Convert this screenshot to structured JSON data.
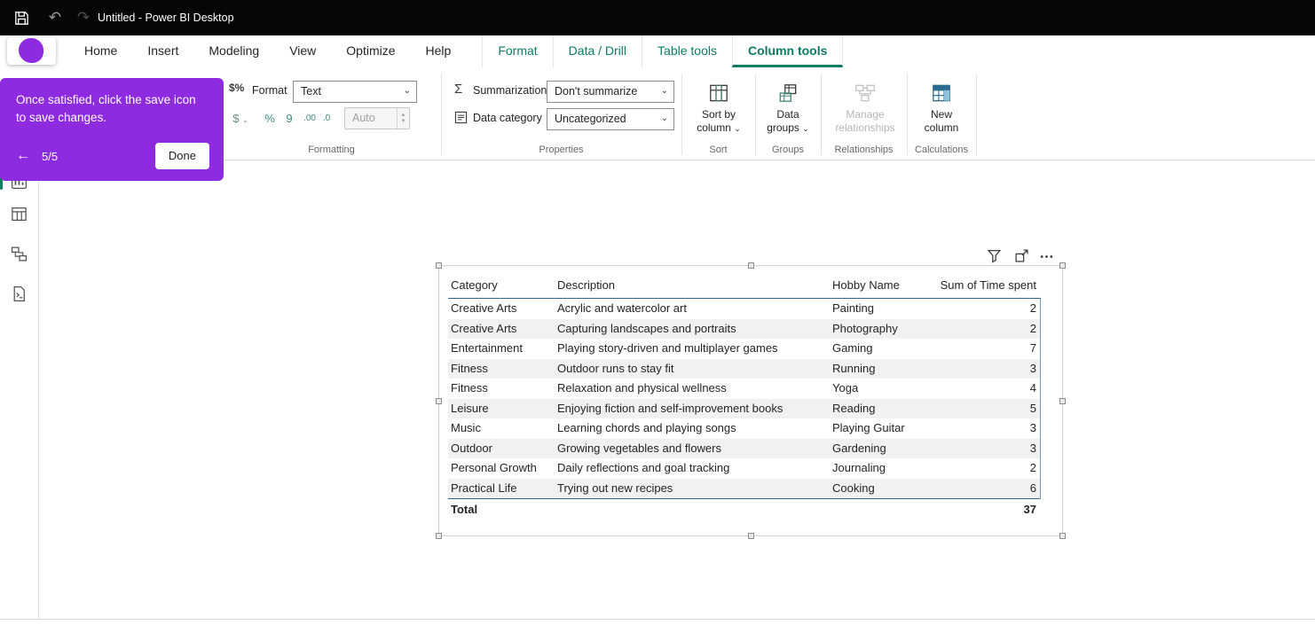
{
  "titlebar": {
    "title": "Untitled - Power BI Desktop"
  },
  "glyphs": {
    "undo": "↶",
    "redo": "↷",
    "sigma": "Σ",
    "chevron": "⌄"
  },
  "tabs": [
    {
      "label": "Home"
    },
    {
      "label": "Insert"
    },
    {
      "label": "Modeling"
    },
    {
      "label": "View"
    },
    {
      "label": "Optimize"
    },
    {
      "label": "Help"
    },
    {
      "label": "Format",
      "contextual": true
    },
    {
      "label": "Data / Drill",
      "contextual": true
    },
    {
      "label": "Table tools",
      "contextual": true
    },
    {
      "label": "Column tools",
      "contextual": true,
      "active": true
    }
  ],
  "ribbon": {
    "formatting": {
      "icon_label": "$%",
      "format_label": "Format",
      "format_value": "Text",
      "currency_symbol": "$",
      "percent_symbol": "%",
      "thousands_symbol": "9",
      "decimal_increase": ".00",
      "decimal_decrease": ".0",
      "auto_value": "Auto",
      "group_label": "Formatting"
    },
    "properties": {
      "summarization_label": "Summarization",
      "summarization_value": "Don't summarize",
      "data_category_label": "Data category",
      "data_category_value": "Uncategorized",
      "group_label": "Properties"
    },
    "sort": {
      "line1": "Sort by",
      "line2": "column",
      "group_label": "Sort"
    },
    "groups": {
      "line1": "Data",
      "line2": "groups",
      "group_label": "Groups"
    },
    "relationships": {
      "line1": "Manage",
      "line2": "relationships",
      "group_label": "Relationships"
    },
    "calculations": {
      "line1": "New",
      "line2": "column",
      "group_label": "Calculations"
    }
  },
  "coachmark": {
    "message": "Once satisfied, click the save icon to save changes.",
    "back_arrow": "←",
    "step": "5/5",
    "done_label": "Done"
  },
  "visual": {
    "table": {
      "columns": [
        "Category",
        "Description",
        "Hobby Name",
        "Sum of Time spent"
      ],
      "rows": [
        {
          "category": "Creative Arts",
          "description": "Acrylic and watercolor art",
          "hobby": "Painting",
          "time": "2"
        },
        {
          "category": "Creative Arts",
          "description": "Capturing landscapes and portraits",
          "hobby": "Photography",
          "time": "2"
        },
        {
          "category": "Entertainment",
          "description": "Playing story-driven and multiplayer games",
          "hobby": "Gaming",
          "time": "7"
        },
        {
          "category": "Fitness",
          "description": "Outdoor runs to stay fit",
          "hobby": "Running",
          "time": "3"
        },
        {
          "category": "Fitness",
          "description": "Relaxation and physical wellness",
          "hobby": "Yoga",
          "time": "4"
        },
        {
          "category": "Leisure",
          "description": "Enjoying fiction and self-improvement books",
          "hobby": "Reading",
          "time": "5"
        },
        {
          "category": "Music",
          "description": "Learning chords and playing songs",
          "hobby": "Playing Guitar",
          "time": "3"
        },
        {
          "category": "Outdoor",
          "description": "Growing vegetables and flowers",
          "hobby": "Gardening",
          "time": "3"
        },
        {
          "category": "Personal Growth",
          "description": "Daily reflections and goal tracking",
          "hobby": "Journaling",
          "time": "2"
        },
        {
          "category": "Practical Life",
          "description": "Trying out new recipes",
          "hobby": "Cooking",
          "time": "6"
        }
      ],
      "total_label": "Total",
      "total_value": "37"
    }
  }
}
